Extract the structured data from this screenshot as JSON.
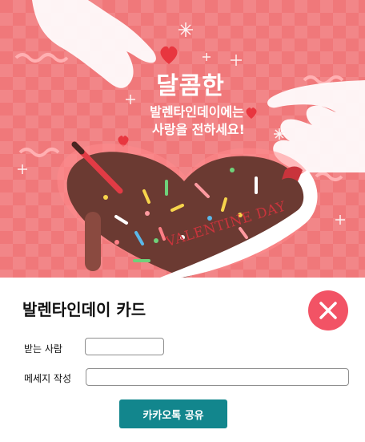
{
  "banner": {
    "title": "달콤한",
    "subtitle_line1": "발렌타인데이에는",
    "subtitle_line2": "사랑을 전하세요!",
    "ribbon_text": "VALENTINE DAY",
    "bg_color": "#f0787a"
  },
  "card": {
    "title": "발렌타인데이 카드",
    "close_icon": "close-x-icon",
    "receiver_label": "받는 사람",
    "receiver_value": "",
    "message_label": "메세지 작성",
    "message_value": "",
    "share_label": "카카오톡 공유",
    "share_color": "#12868d",
    "close_color": "#f25365"
  }
}
